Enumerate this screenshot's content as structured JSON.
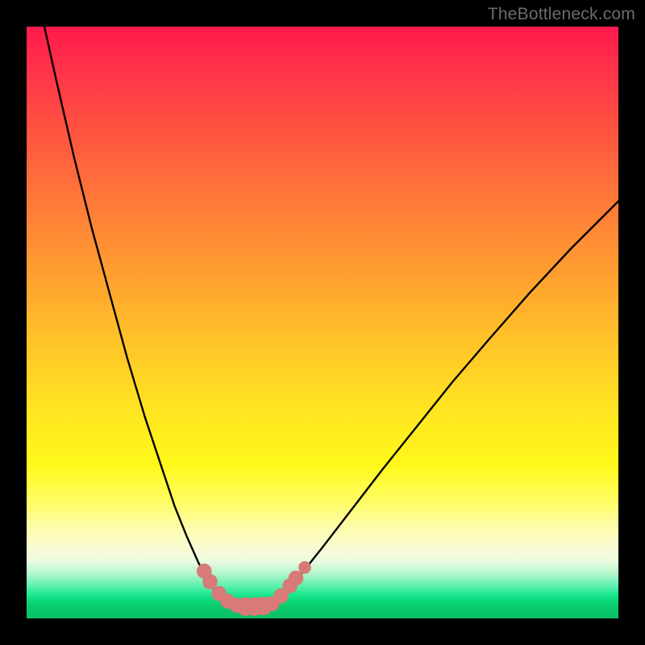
{
  "watermark": {
    "text": "TheBottleneck.com"
  },
  "colors": {
    "curve_stroke": "#000000",
    "marker_fill": "#d87a78",
    "marker_stroke": "#d87a78",
    "frame_bg": "#000000"
  },
  "chart_data": {
    "type": "line",
    "title": "",
    "xlabel": "",
    "ylabel": "",
    "xlim": [
      0,
      100
    ],
    "ylim": [
      0,
      100
    ],
    "grid": false,
    "legend": false,
    "series": [
      {
        "name": "left-branch",
        "x": [
          3,
          5,
          8,
          11,
          14,
          17,
          20,
          23,
          25,
          27,
          29,
          30.5,
          32,
          33.5,
          35
        ],
        "y": [
          100,
          91,
          78,
          66,
          55,
          44,
          34,
          25,
          19,
          14,
          9.5,
          6.5,
          4.5,
          3,
          2.3
        ]
      },
      {
        "name": "flat-bottom",
        "x": [
          35,
          36,
          37,
          38,
          39,
          40,
          41
        ],
        "y": [
          2.3,
          2.1,
          2.0,
          2.0,
          2.0,
          2.1,
          2.3
        ]
      },
      {
        "name": "right-branch",
        "x": [
          41,
          43,
          46,
          50,
          55,
          60,
          66,
          72,
          78,
          85,
          92,
          100
        ],
        "y": [
          2.3,
          3.8,
          7,
          12,
          18.5,
          25,
          32.5,
          40,
          47,
          55,
          62.5,
          70.5
        ]
      }
    ],
    "markers": [
      {
        "x": 30.0,
        "y": 8.0,
        "r": 1.2
      },
      {
        "x": 31.0,
        "y": 6.2,
        "r": 1.2
      },
      {
        "x": 32.5,
        "y": 4.2,
        "r": 1.2
      },
      {
        "x": 34.0,
        "y": 2.9,
        "r": 1.2
      },
      {
        "x": 35.5,
        "y": 2.2,
        "r": 1.2
      },
      {
        "x": 37.0,
        "y": 2.0,
        "r": 1.5
      },
      {
        "x": 38.5,
        "y": 2.0,
        "r": 1.5
      },
      {
        "x": 40.0,
        "y": 2.1,
        "r": 1.5
      },
      {
        "x": 41.5,
        "y": 2.5,
        "r": 1.2
      },
      {
        "x": 43.0,
        "y": 3.8,
        "r": 1.2
      },
      {
        "x": 44.5,
        "y": 5.5,
        "r": 1.2
      },
      {
        "x": 45.5,
        "y": 6.8,
        "r": 1.2
      },
      {
        "x": 47.0,
        "y": 8.6,
        "r": 1.0
      }
    ]
  }
}
